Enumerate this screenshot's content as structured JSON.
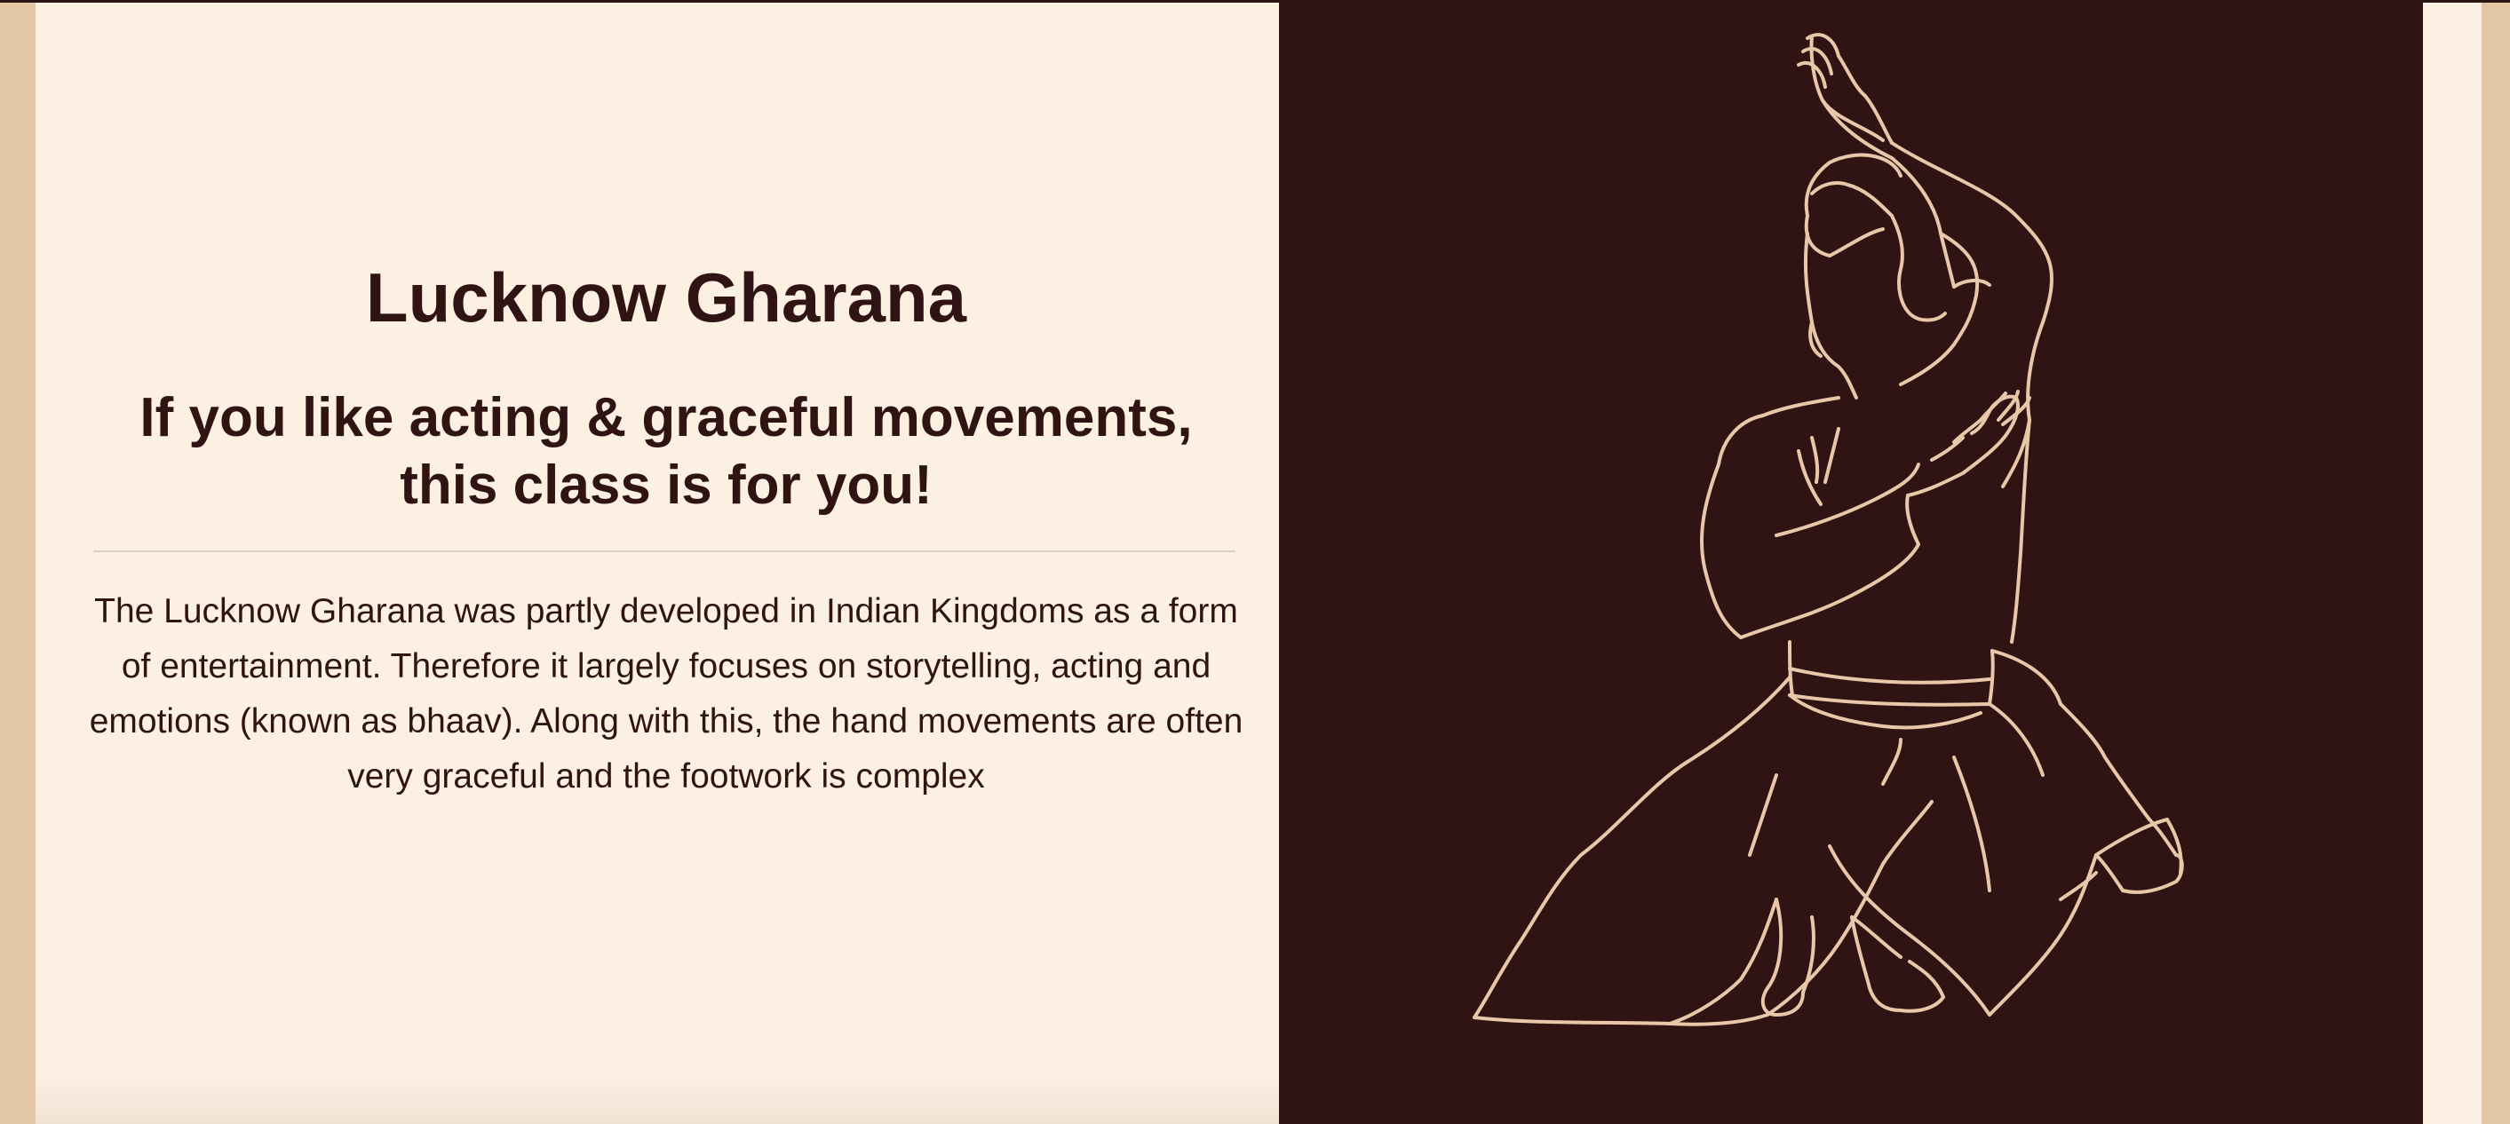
{
  "section": {
    "title": "Lucknow Gharana",
    "subtitle": "If you like acting & graceful movements, this class is for you!",
    "description": "The Lucknow Gharana was partly developed in Indian Kingdoms as a form of entertainment. Therefore it largely focuses on storytelling, acting and emotions (known as bhaav). Along with this, the hand movements are often very graceful and the footwork is complex"
  },
  "illustration": {
    "icon": "kathak-dancer-line-art",
    "line_color": "#e8c8a8",
    "background_color": "#301414"
  },
  "colors": {
    "text": "#301414",
    "panel_background": "#fcf0e3",
    "border_tan": "#e2c6a6"
  }
}
